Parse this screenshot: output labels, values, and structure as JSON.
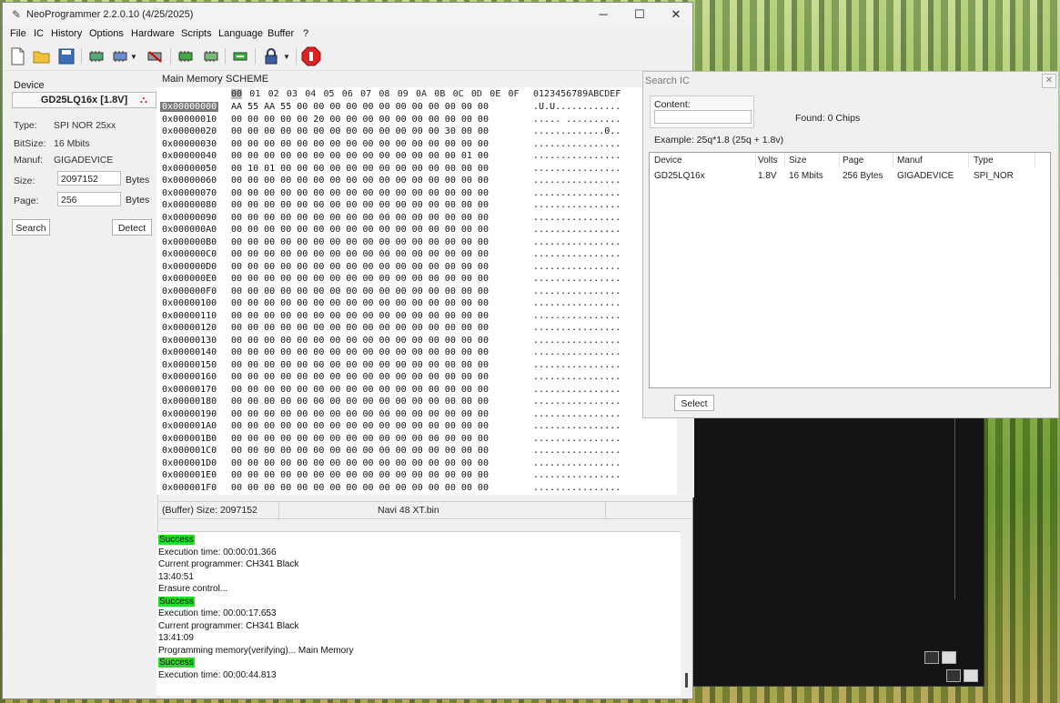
{
  "window": {
    "title": "NeoProgrammer 2.2.0.10 (4/25/2025)",
    "minimize": "─",
    "maximize": "☐",
    "close": "✕"
  },
  "menu": [
    "File",
    "IC",
    "History",
    "Options",
    "Hardware",
    "Scripts",
    "Language",
    "Buffer",
    "?"
  ],
  "device": {
    "group_label": "Device",
    "name": "GD25LQ16x [1.8V]",
    "type_label": "Type:",
    "type_value": "SPI NOR 25xx",
    "bitsize_label": "BitSize:",
    "bitsize_value": "16 Mbits",
    "manuf_label": "Manuf:",
    "manuf_value": "GIGADEVICE",
    "size_label": "Size:",
    "size_value": "2097152",
    "size_unit": "Bytes",
    "page_label": "Page:",
    "page_value": "256",
    "page_unit": "Bytes",
    "search_button": "Search",
    "detect_button": "Detect"
  },
  "hex": {
    "tabs": [
      "Main Memory",
      "SCHEME"
    ],
    "columns": [
      "00",
      "01",
      "02",
      "03",
      "04",
      "05",
      "06",
      "07",
      "08",
      "09",
      "0A",
      "0B",
      "0C",
      "0D",
      "0E",
      "0F"
    ],
    "ascii_header": "0123456789ABCDEF",
    "rows": [
      {
        "addr": "0x00000000",
        "bytes": "AA 55 AA 55 00 00 00 00 00 00 00 00 00 00 00 00",
        "ascii": ".U.U............"
      },
      {
        "addr": "0x00000010",
        "bytes": "00 00 00 00 00 20 00 00 00 00 00 00 00 00 00 00",
        "ascii": "..... .........."
      },
      {
        "addr": "0x00000020",
        "bytes": "00 00 00 00 00 00 00 00 00 00 00 00 00 30 00 00",
        "ascii": ".............0.."
      },
      {
        "addr": "0x00000030",
        "bytes": "00 00 00 00 00 00 00 00 00 00 00 00 00 00 00 00",
        "ascii": "................"
      },
      {
        "addr": "0x00000040",
        "bytes": "00 00 00 00 00 00 00 00 00 00 00 00 00 00 01 00",
        "ascii": "................"
      },
      {
        "addr": "0x00000050",
        "bytes": "00 10 01 00 00 00 00 00 00 00 00 00 00 00 00 00",
        "ascii": "................"
      },
      {
        "addr": "0x00000060",
        "bytes": "00 00 00 00 00 00 00 00 00 00 00 00 00 00 00 00",
        "ascii": "................"
      },
      {
        "addr": "0x00000070",
        "bytes": "00 00 00 00 00 00 00 00 00 00 00 00 00 00 00 00",
        "ascii": "................"
      },
      {
        "addr": "0x00000080",
        "bytes": "00 00 00 00 00 00 00 00 00 00 00 00 00 00 00 00",
        "ascii": "................"
      },
      {
        "addr": "0x00000090",
        "bytes": "00 00 00 00 00 00 00 00 00 00 00 00 00 00 00 00",
        "ascii": "................"
      },
      {
        "addr": "0x000000A0",
        "bytes": "00 00 00 00 00 00 00 00 00 00 00 00 00 00 00 00",
        "ascii": "................"
      },
      {
        "addr": "0x000000B0",
        "bytes": "00 00 00 00 00 00 00 00 00 00 00 00 00 00 00 00",
        "ascii": "................"
      },
      {
        "addr": "0x000000C0",
        "bytes": "00 00 00 00 00 00 00 00 00 00 00 00 00 00 00 00",
        "ascii": "................"
      },
      {
        "addr": "0x000000D0",
        "bytes": "00 00 00 00 00 00 00 00 00 00 00 00 00 00 00 00",
        "ascii": "................"
      },
      {
        "addr": "0x000000E0",
        "bytes": "00 00 00 00 00 00 00 00 00 00 00 00 00 00 00 00",
        "ascii": "................"
      },
      {
        "addr": "0x000000F0",
        "bytes": "00 00 00 00 00 00 00 00 00 00 00 00 00 00 00 00",
        "ascii": "................"
      },
      {
        "addr": "0x00000100",
        "bytes": "00 00 00 00 00 00 00 00 00 00 00 00 00 00 00 00",
        "ascii": "................"
      },
      {
        "addr": "0x00000110",
        "bytes": "00 00 00 00 00 00 00 00 00 00 00 00 00 00 00 00",
        "ascii": "................"
      },
      {
        "addr": "0x00000120",
        "bytes": "00 00 00 00 00 00 00 00 00 00 00 00 00 00 00 00",
        "ascii": "................"
      },
      {
        "addr": "0x00000130",
        "bytes": "00 00 00 00 00 00 00 00 00 00 00 00 00 00 00 00",
        "ascii": "................"
      },
      {
        "addr": "0x00000140",
        "bytes": "00 00 00 00 00 00 00 00 00 00 00 00 00 00 00 00",
        "ascii": "................"
      },
      {
        "addr": "0x00000150",
        "bytes": "00 00 00 00 00 00 00 00 00 00 00 00 00 00 00 00",
        "ascii": "................"
      },
      {
        "addr": "0x00000160",
        "bytes": "00 00 00 00 00 00 00 00 00 00 00 00 00 00 00 00",
        "ascii": "................"
      },
      {
        "addr": "0x00000170",
        "bytes": "00 00 00 00 00 00 00 00 00 00 00 00 00 00 00 00",
        "ascii": "................"
      },
      {
        "addr": "0x00000180",
        "bytes": "00 00 00 00 00 00 00 00 00 00 00 00 00 00 00 00",
        "ascii": "................"
      },
      {
        "addr": "0x00000190",
        "bytes": "00 00 00 00 00 00 00 00 00 00 00 00 00 00 00 00",
        "ascii": "................"
      },
      {
        "addr": "0x000001A0",
        "bytes": "00 00 00 00 00 00 00 00 00 00 00 00 00 00 00 00",
        "ascii": "................"
      },
      {
        "addr": "0x000001B0",
        "bytes": "00 00 00 00 00 00 00 00 00 00 00 00 00 00 00 00",
        "ascii": "................"
      },
      {
        "addr": "0x000001C0",
        "bytes": "00 00 00 00 00 00 00 00 00 00 00 00 00 00 00 00",
        "ascii": "................"
      },
      {
        "addr": "0x000001D0",
        "bytes": "00 00 00 00 00 00 00 00 00 00 00 00 00 00 00 00",
        "ascii": "................"
      },
      {
        "addr": "0x000001E0",
        "bytes": "00 00 00 00 00 00 00 00 00 00 00 00 00 00 00 00",
        "ascii": "................"
      },
      {
        "addr": "0x000001F0",
        "bytes": "00 00 00 00 00 00 00 00 00 00 00 00 00 00 00 00",
        "ascii": "................"
      }
    ]
  },
  "status": {
    "buffer": "(Buffer) Size: 2097152",
    "file": "Navi 48 XT.bin"
  },
  "log": [
    {
      "text": "Success",
      "ok": true
    },
    {
      "text": "Execution time: 00:00:01.366"
    },
    {
      "text": "Current programmer: CH341 Black"
    },
    {
      "text": "13:40:51"
    },
    {
      "text": "Erasure control..."
    },
    {
      "text": "Success",
      "ok": true
    },
    {
      "text": "Execution time: 00:00:17.653"
    },
    {
      "text": "Current programmer: CH341 Black"
    },
    {
      "text": "13:41:09"
    },
    {
      "text": "Programming memory(verifying)... Main Memory"
    },
    {
      "text": "Success",
      "ok": true
    },
    {
      "text": "Execution time: 00:00:44.813"
    }
  ],
  "search_ic": {
    "title": "Search IC",
    "close": "✕",
    "content_label": "Content:",
    "content_value": "",
    "found": "Found: 0 Chips",
    "example": "Example:  25q*1.8 (25q + 1.8v)",
    "columns": [
      "Device",
      "Volts",
      "Size",
      "Page",
      "Manuf",
      "Type"
    ],
    "rows": [
      {
        "device": "GD25LQ16x",
        "volts": "1.8V",
        "size": "16 Mbits",
        "page": "256 Bytes",
        "manuf": "GIGADEVICE",
        "type": "SPI_NOR"
      }
    ],
    "select_button": "Select"
  },
  "colors": {
    "success_bg": "#22e022",
    "selected_addr_bg": "#7a7a7a"
  }
}
